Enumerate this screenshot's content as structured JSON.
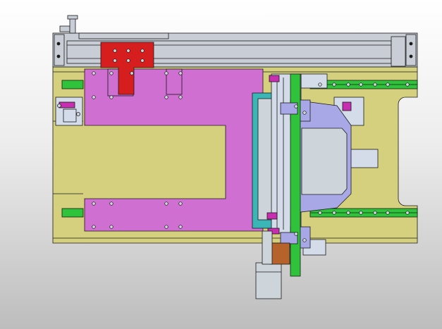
{
  "viewport": {
    "background_top": "#ffffff",
    "background_bottom": "#bdbdbd"
  },
  "colors": {
    "base_plate": "#d4d07e",
    "rail_housing": "#c9ced6",
    "slide_plate": "#cf6fd1",
    "red_block": "#d61e1e",
    "guide_rail": "#2fc23b",
    "carriage": "#a9a8e6",
    "bracket": "#d3dce8",
    "teal_plate": "#3ab6b6",
    "motor": "#cdd4da",
    "copper_part": "#b5632b",
    "magenta_accent": "#c72fb0",
    "outline": "#1a1a1a"
  },
  "components": [
    {
      "name": "base-plate",
      "label": ""
    },
    {
      "name": "linear-actuator",
      "label": ""
    },
    {
      "name": "slide-plate",
      "label": ""
    },
    {
      "name": "gripper-assembly",
      "label": ""
    },
    {
      "name": "guide-rails",
      "label": ""
    },
    {
      "name": "pneumatic-cylinder",
      "label": ""
    }
  ]
}
